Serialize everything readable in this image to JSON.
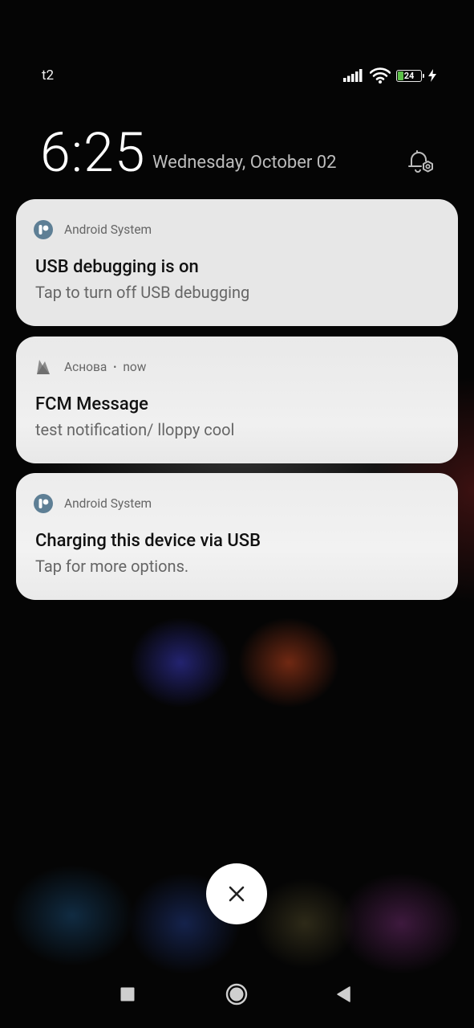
{
  "status_bar": {
    "carrier": "t2",
    "battery_level": "24",
    "battery_color": "#5ec24a",
    "icons": [
      "signal-icon",
      "wifi-icon",
      "battery-icon",
      "charging-bolt-icon"
    ]
  },
  "lockscreen": {
    "time": "6:25",
    "date": "Wednesday, October 02",
    "settings_icon": "notification-settings-icon"
  },
  "notifications": [
    {
      "app": "Android System",
      "time": "",
      "title": "USB debugging is on",
      "body": "Tap to turn off USB debugging",
      "icon": "android-system-icon"
    },
    {
      "app": "Аснова",
      "time": "now",
      "title": "FCM Message",
      "body": "test notification/ lloppy cool",
      "icon": "firebase-icon"
    },
    {
      "app": "Android System",
      "time": "",
      "title": "Charging this device via USB",
      "body": "Tap for more options.",
      "icon": "android-system-icon"
    }
  ],
  "dismiss": {
    "icon": "close-icon"
  },
  "nav_bar": {
    "icons": [
      "recents-icon",
      "home-icon",
      "back-icon"
    ]
  }
}
